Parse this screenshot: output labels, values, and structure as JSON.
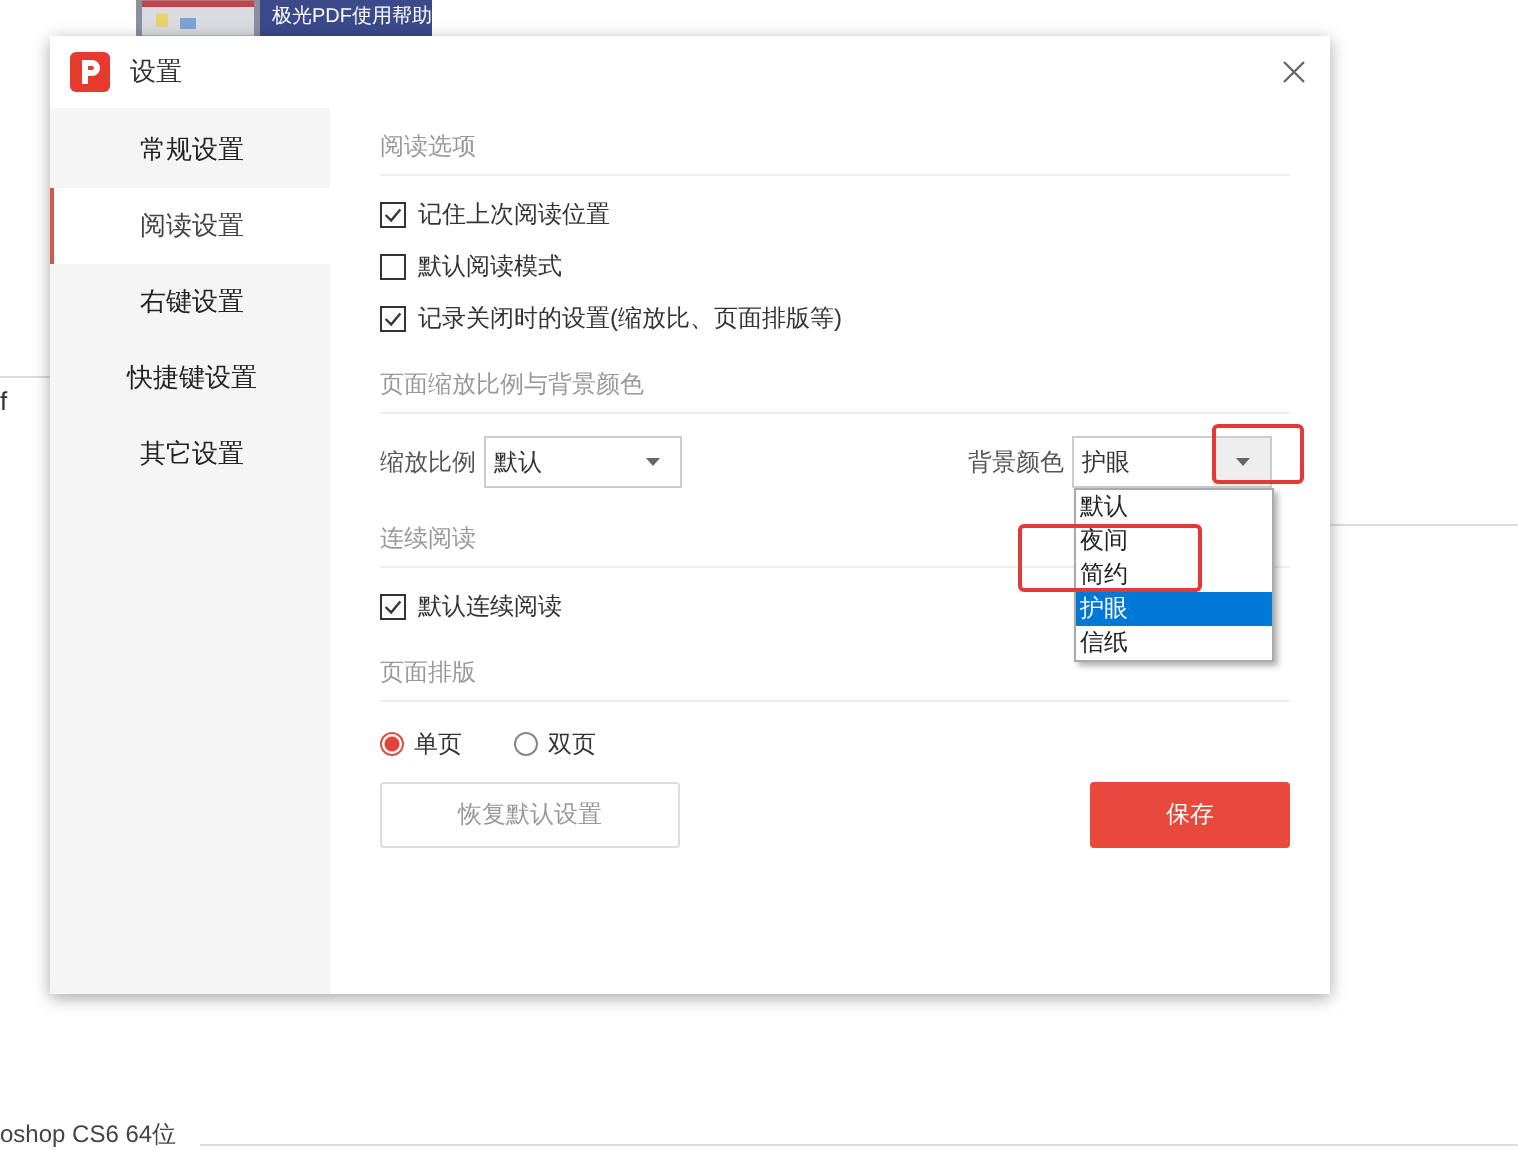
{
  "background": {
    "thumbnail_caption": "极光PDF使用帮助",
    "side_text": "f",
    "bottom_text": "oshop CS6 64位"
  },
  "window": {
    "title": "设置"
  },
  "sidebar": {
    "items": [
      {
        "label": "常规设置",
        "selected": false
      },
      {
        "label": "阅读设置",
        "selected": true
      },
      {
        "label": "右键设置",
        "selected": false
      },
      {
        "label": "快捷键设置",
        "selected": false
      },
      {
        "label": "其它设置",
        "selected": false
      }
    ]
  },
  "sections": [
    {
      "heading": "阅读选项",
      "options": [
        {
          "kind": "checkbox",
          "label": "记住上次阅读位置",
          "checked": true
        },
        {
          "kind": "checkbox",
          "label": "默认阅读模式",
          "checked": false
        },
        {
          "kind": "checkbox",
          "label": "记录关闭时的设置(缩放比、页面排版等)",
          "checked": true
        }
      ]
    },
    {
      "heading": "页面缩放比例与背景颜色",
      "options": [
        {
          "kind": "selects",
          "zoom": {
            "label": "缩放比例",
            "value": "默认"
          },
          "background_color": {
            "label": "背景颜色",
            "value": "护眼",
            "arrow_highlighted": true,
            "expanded": true,
            "options": [
              {
                "label": "默认",
                "selected": false,
                "highlighted": false
              },
              {
                "label": "夜间",
                "selected": false,
                "highlighted": true
              },
              {
                "label": "简约",
                "selected": false,
                "highlighted": true
              },
              {
                "label": "护眼",
                "selected": true,
                "highlighted": false
              },
              {
                "label": "信纸",
                "selected": false,
                "highlighted": false
              }
            ]
          }
        }
      ]
    },
    {
      "heading": "连续阅读",
      "options": [
        {
          "kind": "checkbox",
          "label": "默认连续阅读",
          "checked": true
        }
      ]
    },
    {
      "heading": "页面排版",
      "options": [
        {
          "kind": "radios",
          "items": [
            {
              "label": "单页",
              "selected": true
            },
            {
              "label": "双页",
              "selected": false
            }
          ]
        }
      ]
    }
  ],
  "buttons": {
    "reset": "恢复默认设置",
    "save": "保存"
  }
}
